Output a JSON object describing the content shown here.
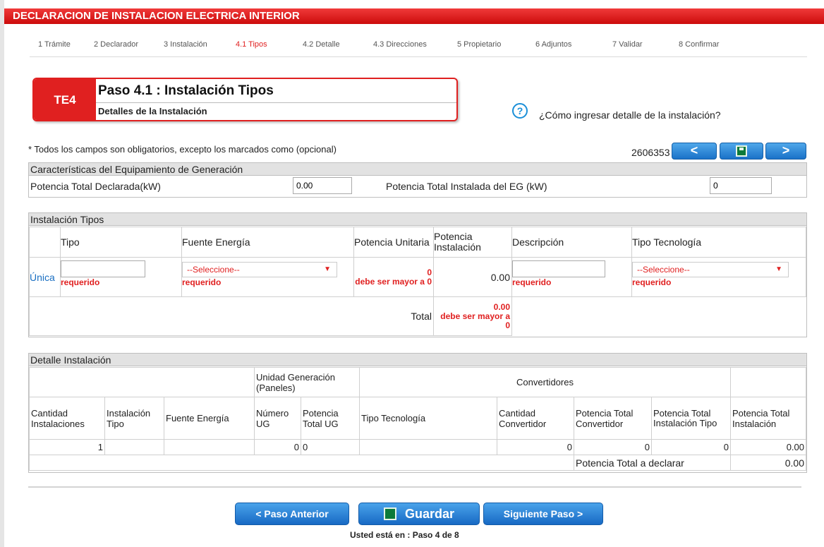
{
  "title_bar": "DECLARACION DE INSTALACION ELECTRICA INTERIOR",
  "steps": [
    "1 Trámite",
    "2 Declarador",
    "3 Instalación",
    "4.1 Tipos",
    "4.2 Detalle",
    "4.3 Direcciones",
    "5 Propietario",
    "6 Adjuntos",
    "7 Validar",
    "8 Confirmar"
  ],
  "active_step": "4.1 Tipos",
  "header": {
    "tag": "TE4",
    "title": "Paso 4.1 : Instalación Tipos",
    "subtitle": "Detalles de la Instalación",
    "help_icon": "question-circle-icon",
    "help_text": "¿Cómo ingresar detalle de la instalación?"
  },
  "required_note": "* Todos los campos son obligatorios, excepto los marcados como (opcional)",
  "record_id": "2606353",
  "top_nav": {
    "prev": "<",
    "save_icon": "floppy-disk-icon",
    "next": ">"
  },
  "equipment": {
    "heading": "Características del Equipamiento de Generación",
    "declared_label": "Potencia Total Declarada(kW)",
    "declared_value": "0.00",
    "installed_label": "Potencia Total Instalada del EG (kW)",
    "installed_value": "0"
  },
  "types": {
    "heading": "Instalación Tipos",
    "col_tipo": "Tipo",
    "col_fuente": "Fuente Energía",
    "col_pot_unitaria": "Potencia Unitaria",
    "col_pot_instalacion": "Potencia Instalación",
    "col_descripcion": "Descripción",
    "col_tecnologia": "Tipo Tecnología",
    "row_label": "Única",
    "required": "requerido",
    "select_placeholder": "--Seleccione--",
    "pot_unitaria_value": "0",
    "pot_unitaria_error": "debe ser mayor a 0",
    "pot_instalacion_value": "0.00",
    "total_label": "Total",
    "total_value": "0.00",
    "total_error": "debe ser mayor a 0"
  },
  "detail": {
    "heading": "Detalle Instalación",
    "group_ug": "Unidad Generación (Paneles)",
    "group_conv": "Convertidores",
    "cols": [
      "Cantidad Instalaciones",
      "Instalación Tipo",
      "Fuente Energía",
      "Número UG",
      "Potencia Total UG",
      "Tipo Tecnología",
      "Cantidad Convertidor",
      "Potencia Total Convertidor",
      "Potencia Total Instalación Tipo",
      "Potencia Total Instalación"
    ],
    "row": [
      "1",
      "",
      "",
      "0",
      "0",
      "",
      "0",
      "0",
      "0",
      "0.00"
    ],
    "footer_label": "Potencia Total a declarar",
    "footer_value": "0.00"
  },
  "bottom_nav": {
    "prev": "< Paso Anterior",
    "save": "Guardar",
    "next": "Siguiente Paso >",
    "status": "Usted está en : Paso 4 de 8"
  }
}
